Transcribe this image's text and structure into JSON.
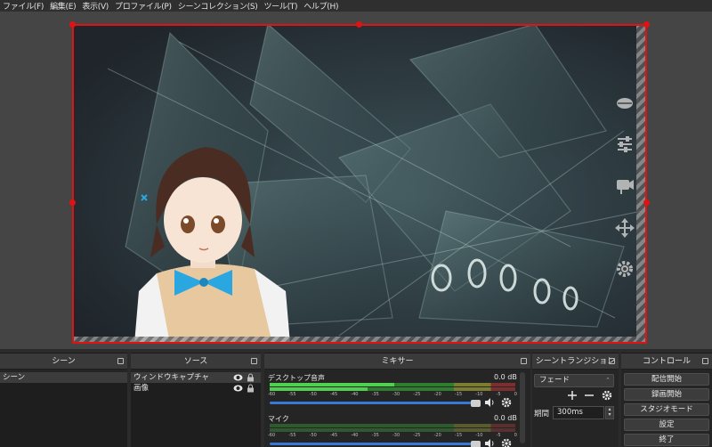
{
  "menu": [
    {
      "label": "ファイル(F)"
    },
    {
      "label": "編集(E)"
    },
    {
      "label": "表示(V)"
    },
    {
      "label": "プロファイル(P)"
    },
    {
      "label": "シーンコレクション(S)"
    },
    {
      "label": "ツール(T)"
    },
    {
      "label": "ヘルプ(H)"
    }
  ],
  "preview": {
    "selection_color": "#e01212",
    "overlay_icons": [
      "mouth-icon",
      "sliders-icon",
      "camera-icon",
      "move-icon",
      "gear-icon"
    ]
  },
  "docks": {
    "scenes": {
      "title": "シーン",
      "items": [
        "シーン"
      ]
    },
    "sources": {
      "title": "ソース",
      "items": [
        "ウィンドウキャプチャ",
        "画像"
      ]
    },
    "mixer": {
      "title": "ミキサー",
      "scale_labels": [
        "-60",
        "-55",
        "-50",
        "-45",
        "-40",
        "-35",
        "-30",
        "-25",
        "-20",
        "-15",
        "-10",
        "-5",
        "0"
      ],
      "channels": [
        {
          "name": "デスクトップ音声",
          "db": "0.0 dB",
          "volume": 1.0
        },
        {
          "name": "マイク",
          "db": "0.0 dB",
          "volume": 1.0
        }
      ]
    },
    "transitions": {
      "title": "シーントランジション",
      "selected": "フェード",
      "duration_label": "期間",
      "duration_value": "300ms"
    },
    "controls": {
      "title": "コントロール",
      "buttons": [
        "配信開始",
        "録画開始",
        "スタジオモード",
        "設定",
        "終了"
      ]
    }
  }
}
